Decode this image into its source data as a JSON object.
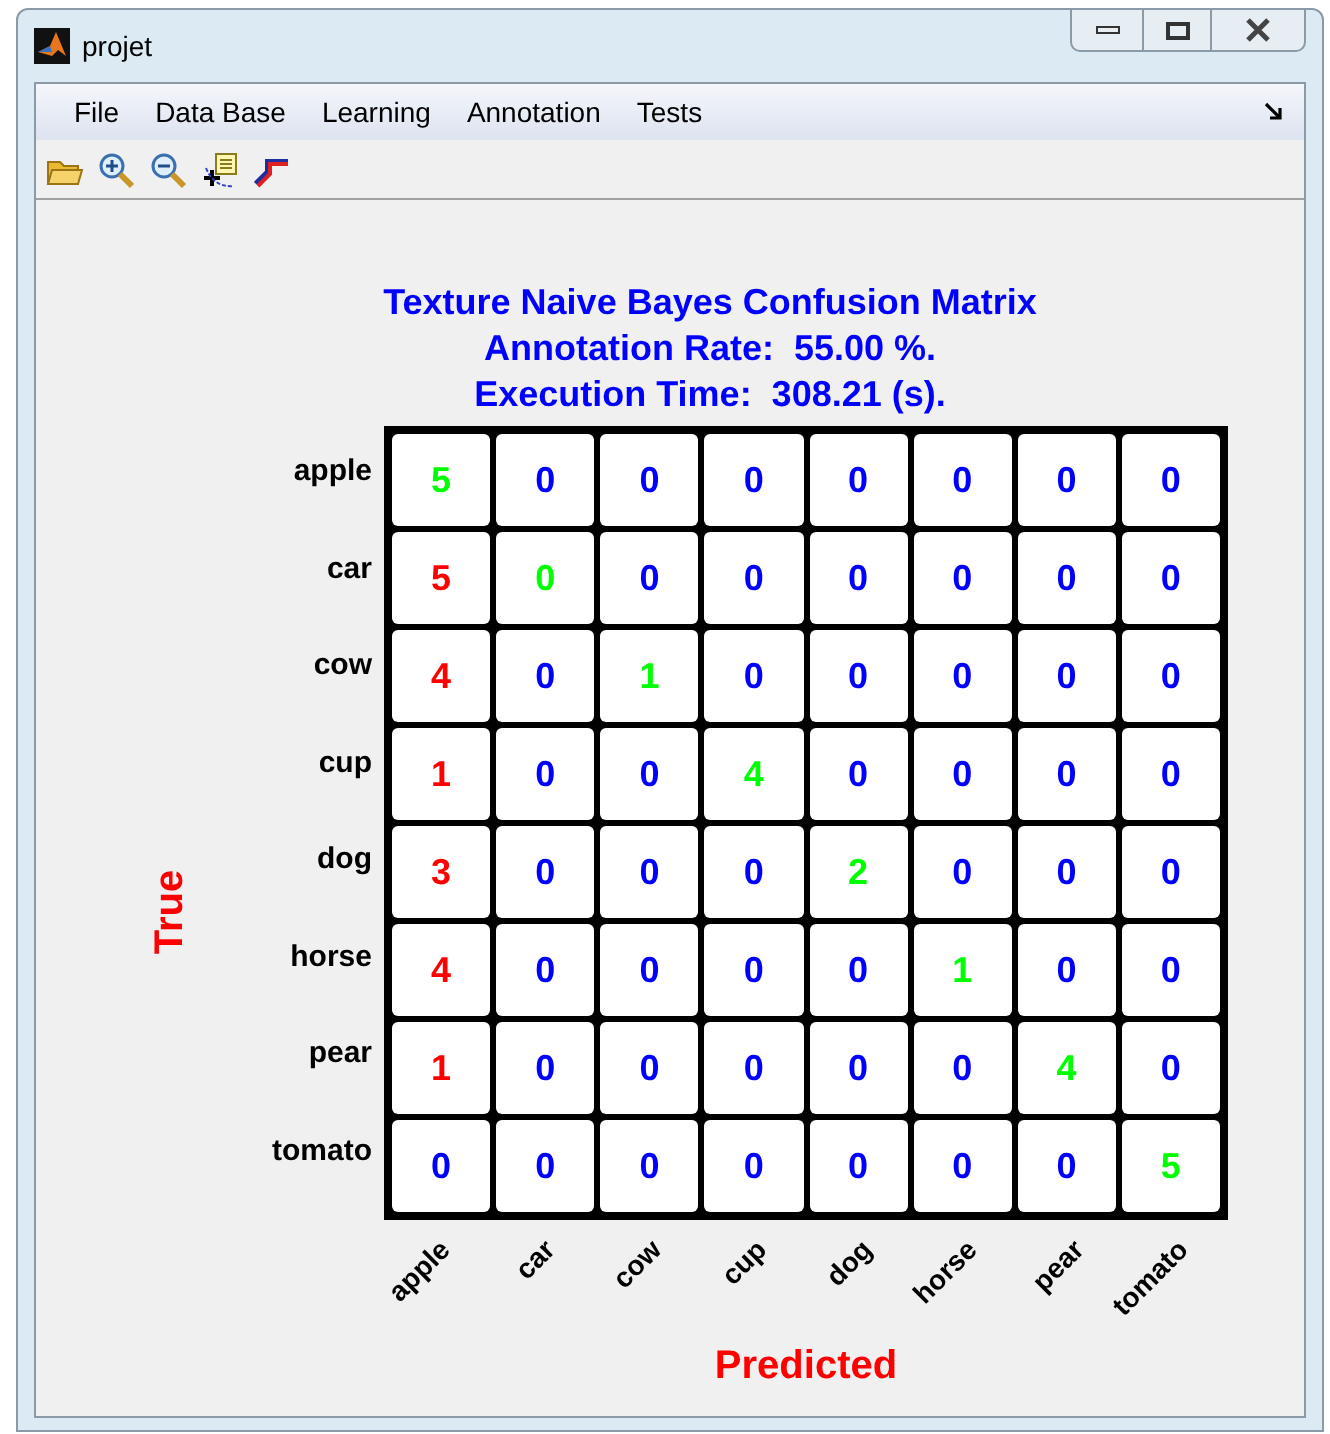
{
  "window": {
    "title": "projet"
  },
  "menu": [
    "File",
    "Data Base",
    "Learning",
    "Annotation",
    "Tests"
  ],
  "chart": {
    "title_lines": [
      "Texture Naive Bayes Confusion Matrix",
      "Annotation Rate:  55.00 %.",
      "Execution Time:  308.21 (s)."
    ],
    "ylabel": "True",
    "xlabel": "Predicted",
    "row_labels": [
      "apple",
      "car",
      "cow",
      "cup",
      "dog",
      "horse",
      "pear",
      "tomato"
    ],
    "column_labels": [
      "apple",
      "car",
      "cow",
      "cup",
      "dog",
      "horse",
      "pear",
      "tomato"
    ],
    "rows": [
      [
        {
          "value": "5",
          "color": "#00ff00"
        },
        {
          "value": "0",
          "color": "#0000ff"
        },
        {
          "value": "0",
          "color": "#0000ff"
        },
        {
          "value": "0",
          "color": "#0000ff"
        },
        {
          "value": "0",
          "color": "#0000ff"
        },
        {
          "value": "0",
          "color": "#0000ff"
        },
        {
          "value": "0",
          "color": "#0000ff"
        },
        {
          "value": "0",
          "color": "#0000ff"
        }
      ],
      [
        {
          "value": "5",
          "color": "#ff0000"
        },
        {
          "value": "0",
          "color": "#00ff00"
        },
        {
          "value": "0",
          "color": "#0000ff"
        },
        {
          "value": "0",
          "color": "#0000ff"
        },
        {
          "value": "0",
          "color": "#0000ff"
        },
        {
          "value": "0",
          "color": "#0000ff"
        },
        {
          "value": "0",
          "color": "#0000ff"
        },
        {
          "value": "0",
          "color": "#0000ff"
        }
      ],
      [
        {
          "value": "4",
          "color": "#ff0000"
        },
        {
          "value": "0",
          "color": "#0000ff"
        },
        {
          "value": "1",
          "color": "#00ff00"
        },
        {
          "value": "0",
          "color": "#0000ff"
        },
        {
          "value": "0",
          "color": "#0000ff"
        },
        {
          "value": "0",
          "color": "#0000ff"
        },
        {
          "value": "0",
          "color": "#0000ff"
        },
        {
          "value": "0",
          "color": "#0000ff"
        }
      ],
      [
        {
          "value": "1",
          "color": "#ff0000"
        },
        {
          "value": "0",
          "color": "#0000ff"
        },
        {
          "value": "0",
          "color": "#0000ff"
        },
        {
          "value": "4",
          "color": "#00ff00"
        },
        {
          "value": "0",
          "color": "#0000ff"
        },
        {
          "value": "0",
          "color": "#0000ff"
        },
        {
          "value": "0",
          "color": "#0000ff"
        },
        {
          "value": "0",
          "color": "#0000ff"
        }
      ],
      [
        {
          "value": "3",
          "color": "#ff0000"
        },
        {
          "value": "0",
          "color": "#0000ff"
        },
        {
          "value": "0",
          "color": "#0000ff"
        },
        {
          "value": "0",
          "color": "#0000ff"
        },
        {
          "value": "2",
          "color": "#00ff00"
        },
        {
          "value": "0",
          "color": "#0000ff"
        },
        {
          "value": "0",
          "color": "#0000ff"
        },
        {
          "value": "0",
          "color": "#0000ff"
        }
      ],
      [
        {
          "value": "4",
          "color": "#ff0000"
        },
        {
          "value": "0",
          "color": "#0000ff"
        },
        {
          "value": "0",
          "color": "#0000ff"
        },
        {
          "value": "0",
          "color": "#0000ff"
        },
        {
          "value": "0",
          "color": "#0000ff"
        },
        {
          "value": "1",
          "color": "#00ff00"
        },
        {
          "value": "0",
          "color": "#0000ff"
        },
        {
          "value": "0",
          "color": "#0000ff"
        }
      ],
      [
        {
          "value": "1",
          "color": "#ff0000"
        },
        {
          "value": "0",
          "color": "#0000ff"
        },
        {
          "value": "0",
          "color": "#0000ff"
        },
        {
          "value": "0",
          "color": "#0000ff"
        },
        {
          "value": "0",
          "color": "#0000ff"
        },
        {
          "value": "0",
          "color": "#0000ff"
        },
        {
          "value": "4",
          "color": "#00ff00"
        },
        {
          "value": "0",
          "color": "#0000ff"
        }
      ],
      [
        {
          "value": "0",
          "color": "#0000ff"
        },
        {
          "value": "0",
          "color": "#0000ff"
        },
        {
          "value": "0",
          "color": "#0000ff"
        },
        {
          "value": "0",
          "color": "#0000ff"
        },
        {
          "value": "0",
          "color": "#0000ff"
        },
        {
          "value": "0",
          "color": "#0000ff"
        },
        {
          "value": "0",
          "color": "#0000ff"
        },
        {
          "value": "5",
          "color": "#00ff00"
        }
      ]
    ]
  }
}
